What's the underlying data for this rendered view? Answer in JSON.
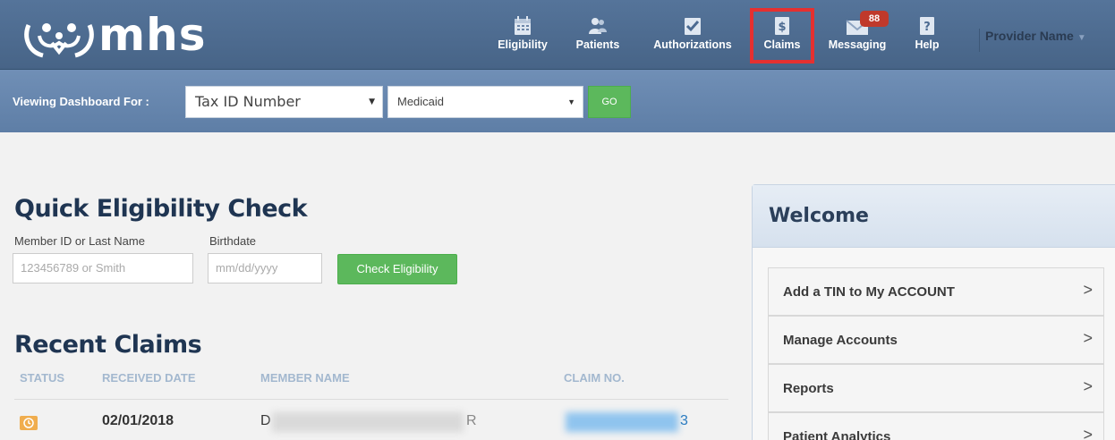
{
  "logo": {
    "text": "mhs"
  },
  "nav": {
    "items": [
      {
        "label": "Eligibility",
        "icon": "calendar-icon"
      },
      {
        "label": "Patients",
        "icon": "users-icon"
      },
      {
        "label": "Authorizations",
        "icon": "checkmark-icon"
      },
      {
        "label": "Claims",
        "icon": "dollar-document-icon"
      },
      {
        "label": "Messaging",
        "icon": "envelope-icon"
      },
      {
        "label": "Help",
        "icon": "question-icon"
      }
    ],
    "messaging_badge": "88",
    "user_name": "Provider Name",
    "highlight_color": "#e53030"
  },
  "subbar": {
    "viewing_label": "Viewing Dashboard For :",
    "tax_select": "Tax ID Number",
    "plan_select": "Medicaid",
    "go_label": "GO"
  },
  "quick_check": {
    "title": "Quick Eligibility Check",
    "member_label": "Member ID or Last Name",
    "member_placeholder": "123456789 or Smith",
    "birth_label": "Birthdate",
    "birth_placeholder": "mm/dd/yyyy",
    "button_label": "Check Eligibility"
  },
  "recent_claims": {
    "title": "Recent Claims",
    "columns": [
      "STATUS",
      "RECEIVED DATE",
      "MEMBER NAME",
      "CLAIM NO."
    ],
    "rows": [
      {
        "received_date": "02/01/2018",
        "member_name_start": "D",
        "member_name_end": "R",
        "claim_end": "3"
      }
    ]
  },
  "welcome": {
    "title": "Welcome",
    "items": [
      "Add a TIN to My ACCOUNT",
      "Manage Accounts",
      "Reports",
      "Patient Analytics"
    ],
    "chevron": ">"
  }
}
